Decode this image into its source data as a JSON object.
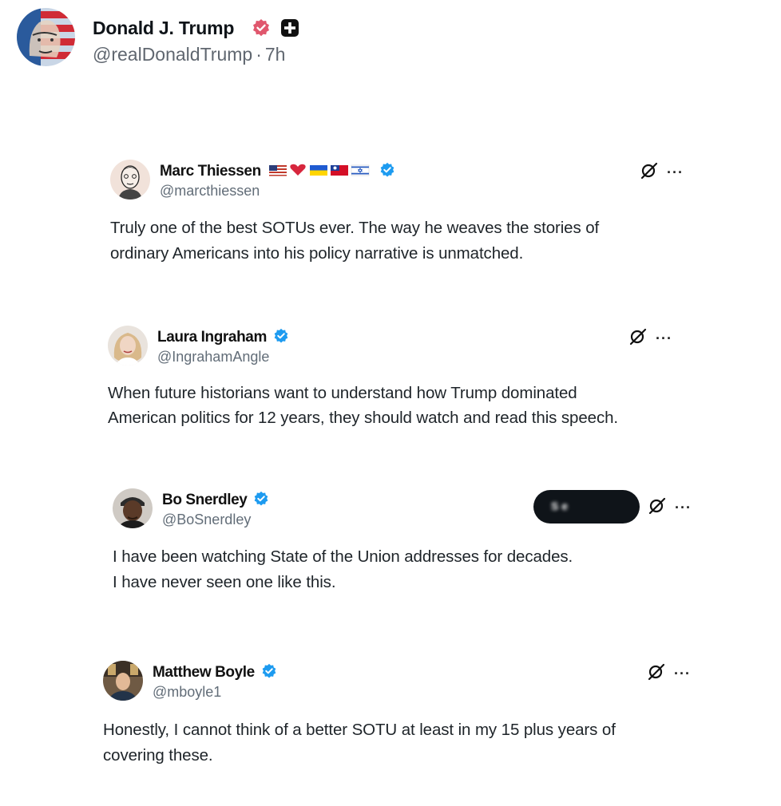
{
  "post": {
    "author_name": "Donald J. Trump",
    "handle": "@realDonaldTrump",
    "separator": "·",
    "time": "7h"
  },
  "quotes": [
    {
      "name": "Marc Thiessen",
      "handle": "@marcthiessen",
      "lines": [
        "Truly one of the best SOTUs ever. The way he weaves the stories of",
        "ordinary Americans into his policy narrative is unmatched."
      ],
      "emoji_flags": [
        "us-flag",
        "red-heart",
        "ukraine-flag",
        "taiwan-flag",
        "israel-flag"
      ]
    },
    {
      "name": "Laura Ingraham",
      "handle": "@IngrahamAngle",
      "lines": [
        "When future historians want to understand how Trump dominated",
        "American politics for 12 years, they should watch and read this speech."
      ]
    },
    {
      "name": "Bo Snerdley",
      "handle": "@BoSnerdley",
      "lines": [
        "I have been watching State of the Union addresses for decades.",
        "I have never seen one like this."
      ],
      "pill_text": "S      e"
    },
    {
      "name": "Matthew Boyle",
      "handle": "@mboyle1",
      "lines": [
        "Honestly, I cannot think of a better SOTU at least in my 15 plus years of",
        "covering these."
      ]
    }
  ],
  "icons": {
    "more": "···",
    "grok": "grok-icon",
    "verified": "verified-badge-icon",
    "plus": "plus-badge-icon"
  },
  "colors": {
    "verified_pink": "#e0576d",
    "verified_blue": "#1d9bf0",
    "text": "#0f1419",
    "muted": "#606770"
  }
}
